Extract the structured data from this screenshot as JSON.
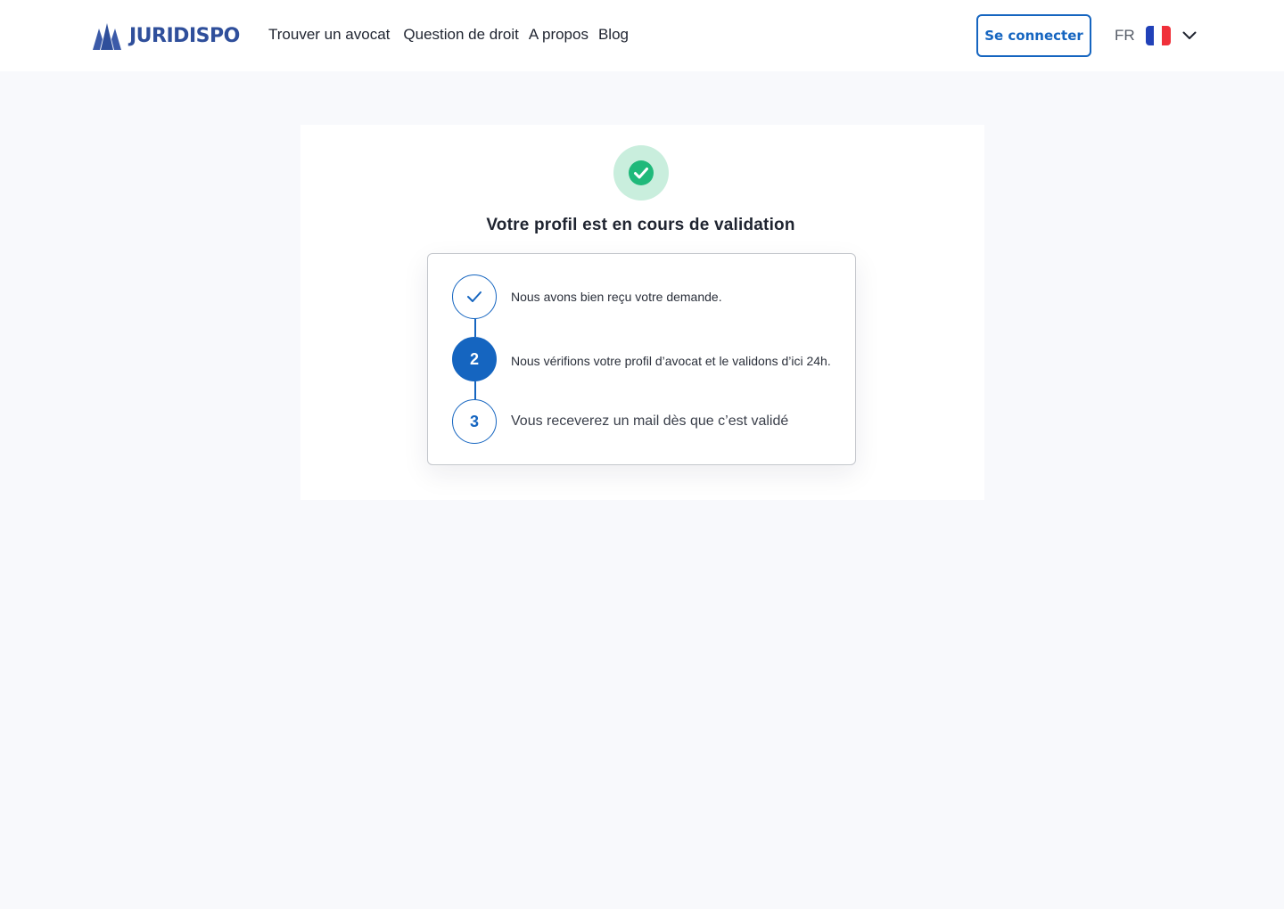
{
  "header": {
    "logo_text": "JURIDISPO",
    "nav": [
      "Trouver un avocat",
      "Question de droit",
      "A propos",
      "Blog"
    ],
    "login_label": "Se connecter",
    "language": {
      "code": "FR",
      "flag": "france-flag"
    }
  },
  "main": {
    "status_icon": "check-circle-icon",
    "title": "Votre profil est en cours de validation",
    "steps": [
      {
        "marker": "check-icon",
        "text": "Nous avons bien reçu votre demande.",
        "state": "done"
      },
      {
        "marker": "2",
        "text": "Nous vérifions votre profil d’avocat et le validons d’ici 24h.",
        "state": "active"
      },
      {
        "marker": "3",
        "text": "Vous receverez un mail dès que c’est validé",
        "state": "pending"
      }
    ]
  },
  "colors": {
    "brand": "#2f4f9b",
    "accent": "#1565c0",
    "success": "#1fb97a",
    "success_bg": "#c9eedd",
    "page_bg": "#f8f9fc"
  }
}
